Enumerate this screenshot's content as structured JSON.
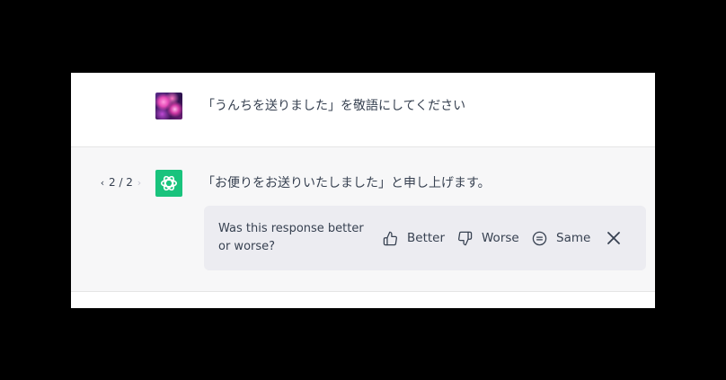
{
  "conversation": {
    "user_message": "「うんちを送りました」を敬語にしてください",
    "assistant_message": "「お便りをお送りいたしました」と申し上げます。",
    "pagination": {
      "prev_icon": "‹",
      "label": "2 / 2",
      "next_icon": "›"
    }
  },
  "feedback": {
    "question": "Was this response better or worse?",
    "better_label": "Better",
    "worse_label": "Worse",
    "same_label": "Same"
  },
  "colors": {
    "gpt_avatar": "#19c37d",
    "assistant_bg": "#f7f7f8",
    "feedback_bg": "#ececf1"
  }
}
